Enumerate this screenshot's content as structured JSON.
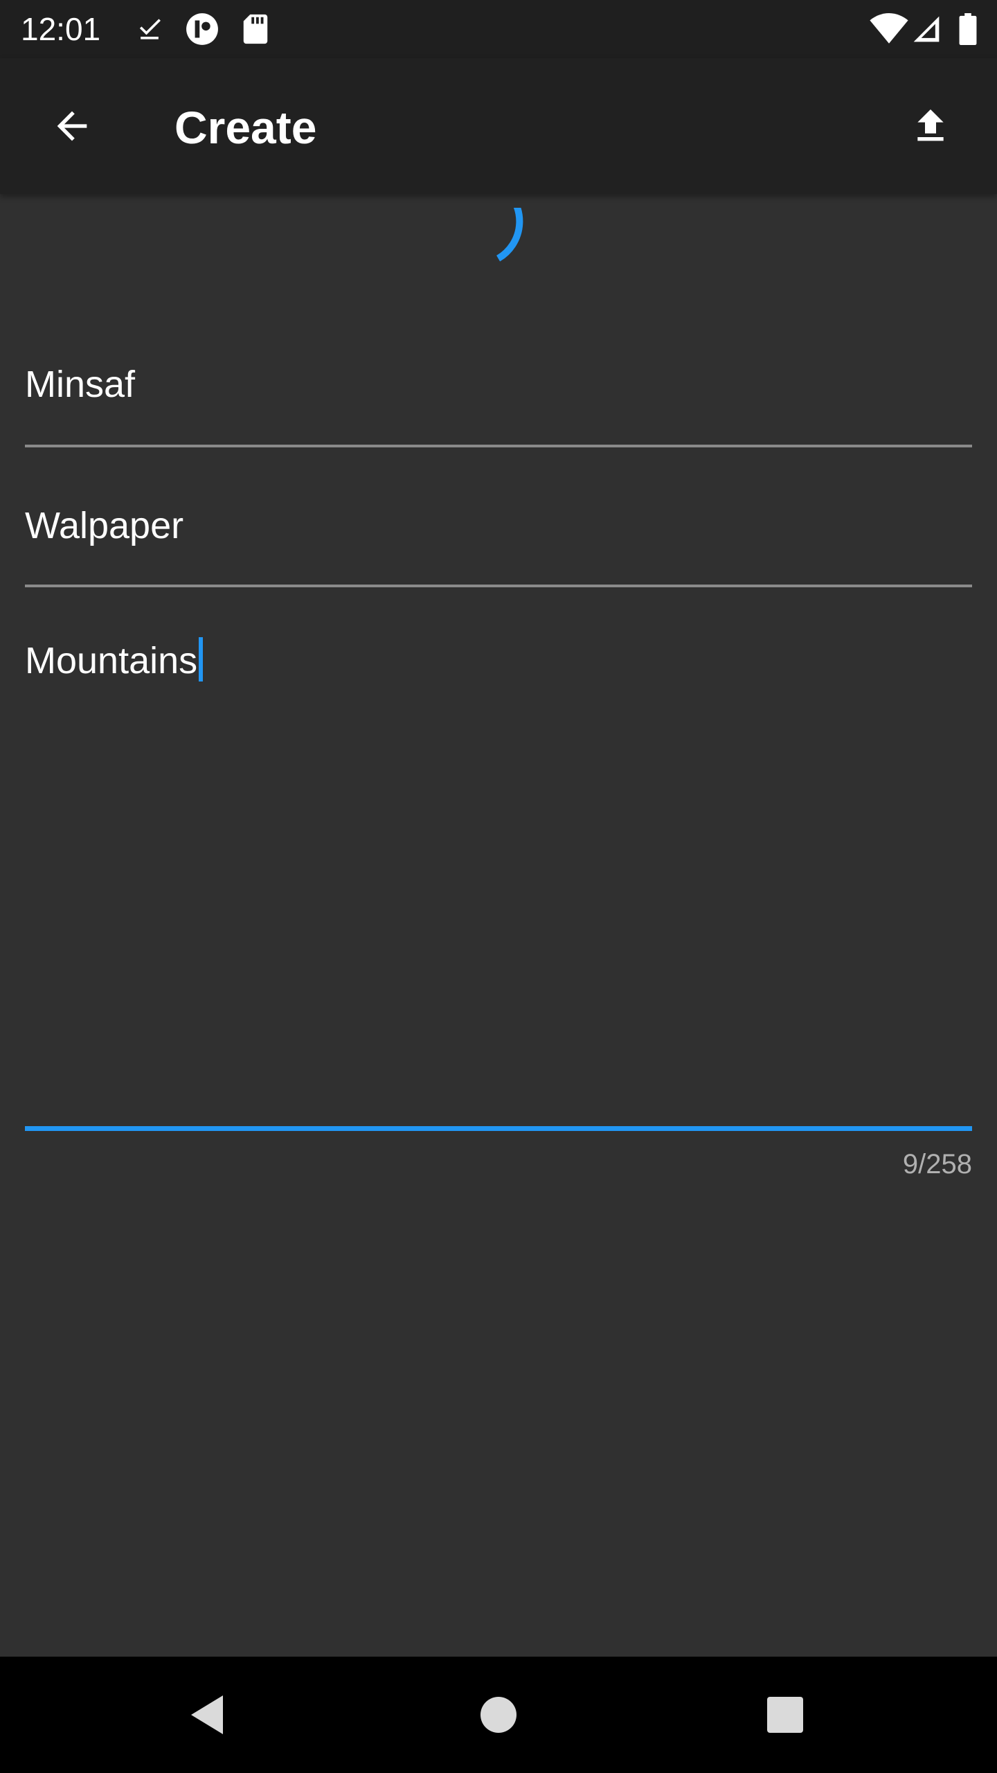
{
  "status_bar": {
    "time": "12:01",
    "icons_left": [
      "download-done-icon",
      "cast-icon",
      "sd-card-icon"
    ],
    "icons_right": [
      "wifi-icon",
      "cellular-signal-icon",
      "battery-icon"
    ]
  },
  "app_bar": {
    "back_icon": "arrow-back-icon",
    "title": "Create",
    "upload_icon": "upload-icon"
  },
  "loading": {
    "indicator": "progress-spinner",
    "color": "#2196f3"
  },
  "form": {
    "title_field": {
      "value": "Minsaf"
    },
    "category_field": {
      "value": "Walpaper"
    },
    "description_field": {
      "value": "Mountains",
      "focused": true
    },
    "char_counter": "9/258"
  },
  "colors": {
    "background": "#303030",
    "app_bar": "#212121",
    "accent": "#2196f3",
    "underline": "#8a8a8a"
  },
  "nav_bar": {
    "back": "nav-back-icon",
    "home": "nav-home-icon",
    "recents": "nav-recents-icon"
  }
}
